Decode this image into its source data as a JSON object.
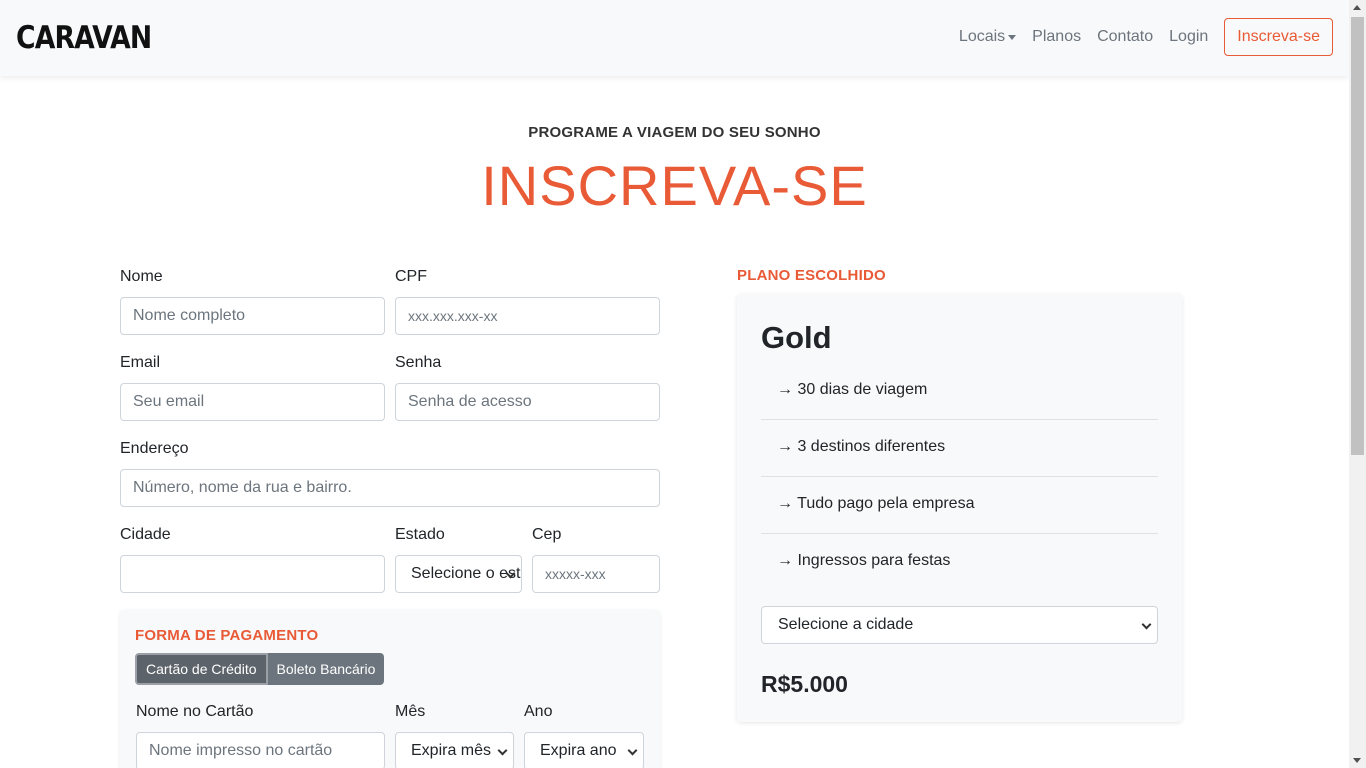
{
  "nav": {
    "brand": "CARAVAN",
    "links": [
      "Locais",
      "Planos",
      "Contato",
      "Login"
    ],
    "signup": "Inscreva-se"
  },
  "hero": {
    "subtitle": "PROGRAME A VIAGEM DO SEU SONHO",
    "title": "INSCREVA-SE"
  },
  "form": {
    "nome": {
      "label": "Nome",
      "placeholder": "Nome completo"
    },
    "cpf": {
      "label": "CPF",
      "placeholder": "xxx.xxx.xxx-xx"
    },
    "email": {
      "label": "Email",
      "placeholder": "Seu email"
    },
    "senha": {
      "label": "Senha",
      "placeholder": "Senha de acesso"
    },
    "endereco": {
      "label": "Endereço",
      "placeholder": "Número, nome da rua e bairro."
    },
    "cidade": {
      "label": "Cidade",
      "value": ""
    },
    "estado": {
      "label": "Estado",
      "selected": "Selecione o estado"
    },
    "cep": {
      "label": "Cep",
      "placeholder": "xxxxx-xxx"
    }
  },
  "payment": {
    "title": "FORMA DE PAGAMENTO",
    "methods": [
      "Cartão de Crédito",
      "Boleto Bancário"
    ],
    "card_name": {
      "label": "Nome no Cartão",
      "placeholder": "Nome impresso no cartão"
    },
    "month": {
      "label": "Mês",
      "selected": "Expira mês"
    },
    "year": {
      "label": "Ano",
      "selected": "Expira ano"
    }
  },
  "plan": {
    "section_title": "PLANO ESCOLHIDO",
    "name": "Gold",
    "features": [
      "→ 30 dias de viagem",
      "→ 3 destinos diferentes",
      "→ Tudo pago pela empresa",
      "→ Ingressos para festas"
    ],
    "city_select": "Selecione a cidade",
    "price": "R$5.000"
  },
  "colors": {
    "accent": "#e95a36",
    "card_bg": "#f8f9fa",
    "button_gray": "#6c757d"
  }
}
